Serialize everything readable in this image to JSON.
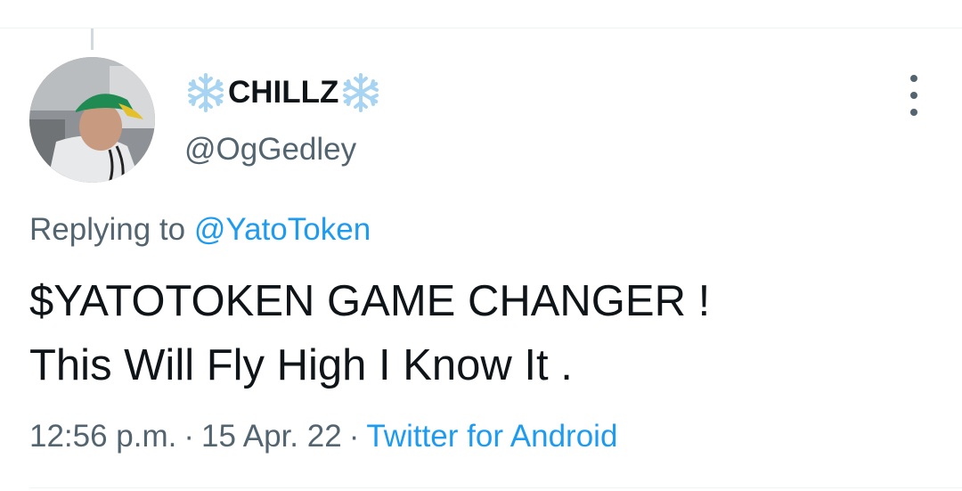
{
  "tweet": {
    "author": {
      "display_name": "CHILLZ",
      "handle": "@OgGedley",
      "name_decoration_icon": "snowflake-icon"
    },
    "reply": {
      "prefix": "Replying to",
      "mention": "@YatoToken"
    },
    "text": "$YATOTOKEN GAME CHANGER !\nThis Will Fly High I Know It .",
    "time": "12:56 p.m.",
    "date": "15 Apr. 22",
    "separator": "·",
    "source": "Twitter for Android",
    "more_icon": "more-vertical-icon"
  },
  "colors": {
    "text_primary": "#0f1419",
    "text_secondary": "#536471",
    "link": "#1d9bf0",
    "snowflake": "#a6d4f2"
  }
}
